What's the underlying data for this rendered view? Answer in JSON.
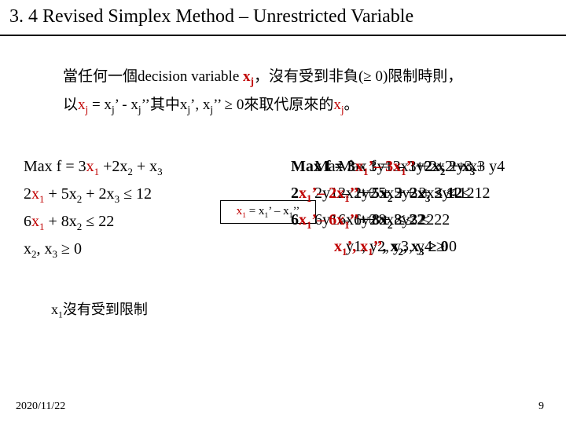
{
  "title": "3. 4 Revised Simplex Method – Unrestricted Variable",
  "intro": {
    "l1a": "當任何一個decision variable ",
    "l1b": "x",
    "l1c": "j",
    "l1d": "，沒有受到非負(≥ 0)限制時則，",
    "l2a": "以",
    "l2b": "x",
    "l2c": "j",
    "l2d": " = x",
    "l2e": "j",
    "l2f": "’ - x",
    "l2g": "j",
    "l2h": "’’其中x",
    "l2i": "j",
    "l2j": "’, x",
    "l2k": "j",
    "l2l": "’’ ≥ 0來取代原來的",
    "l2m": "x",
    "l2n": "j",
    "l2o": "。"
  },
  "left": {
    "r1a": "Max f = 3",
    "r1b": "x",
    "r1c": "1",
    "r1d": " +2x",
    "r1e": "2",
    "r1f": " + x",
    "r1g": "3",
    "r2a": " 2",
    "r2b": "x",
    "r2c": "1",
    "r2d": " + 5x",
    "r2e": "2",
    "r2f": " + 2x",
    "r2g": "3",
    "r2h": " ≤ 12",
    "r3a": " 6",
    "r3b": "x",
    "r3c": "1",
    "r3d": " + 8x",
    "r3e": "2",
    "r3f": "          ≤ 22",
    "r4a": "              x",
    "r4b": "2",
    "r4c": ", x",
    "r4d": "3",
    "r4e": " ≥ 0"
  },
  "arrow": {
    "a1": "x",
    "a2": "1",
    "a3": " = x",
    "a4": "1",
    "a5": "’ – x",
    "a6": "1",
    "a7": "’’"
  },
  "right": {
    "r1_back": "Max f = 3x1  +2x2 + x3",
    "r1_front_a": "Max f = 3",
    "r1_front_b": "x",
    "r1_front_c": "1",
    "r1_front_d": "’– 3",
    "r1_front_e": "x",
    "r1_front_f": "1",
    "r1_front_g": "’’",
    "r1_front_h": "+2x",
    "r1_front_i": "2",
    "r1_front_j": " + x",
    "r1_front_k": "3",
    "r1_y": "Max f = 3y1 – 3y2 + 2y3 + y4",
    "r2_back": " 2x1  + 5x2 + 2x3 ≤ 12",
    "r2_front_a": " 2",
    "r2_front_b": "x",
    "r2_front_c": "1",
    "r2_front_d": "’– 2",
    "r2_front_e": "x",
    "r2_front_f": "1",
    "r2_front_g": "’’",
    "r2_front_h": "+ 5x",
    "r2_front_i": "2",
    "r2_front_j": " + 2x",
    "r2_front_k": "3",
    "r2_front_l": " ≤ 12",
    "r2_y": " 2y1 – 2y2 + 5y3 + 2y4 ≤ 12",
    "r3_back": " 6x1  + 8x2          ≤ 22",
    "r3_front_a": " 6",
    "r3_front_b": "x",
    "r3_front_c": "1",
    "r3_front_d": "’– 6",
    "r3_front_e": "x",
    "r3_front_f": "1",
    "r3_front_g": "’’",
    "r3_front_h": "+ 8x",
    "r3_front_i": "2",
    "r3_front_j": "        ≤ 22",
    "r3_y": " 6y1 – 6y2 + 8y3          ≤ 22",
    "r4_front_a": "x",
    "r4_front_b": "1",
    "r4_front_c": "’, x",
    "r4_front_d": "1",
    "r4_front_e": "’’",
    "r4_front_f": ", x",
    "r4_front_g": "2",
    "r4_front_h": ", x",
    "r4_front_i": "3",
    "r4_front_j": " ≥ 0",
    "r4_y": "y1, y2, y3, y4 ≥ 0"
  },
  "note": {
    "a": "x",
    "b": "1",
    "c": "沒有受到限制"
  },
  "footer": {
    "date": "2020/11/22",
    "page": "9"
  }
}
